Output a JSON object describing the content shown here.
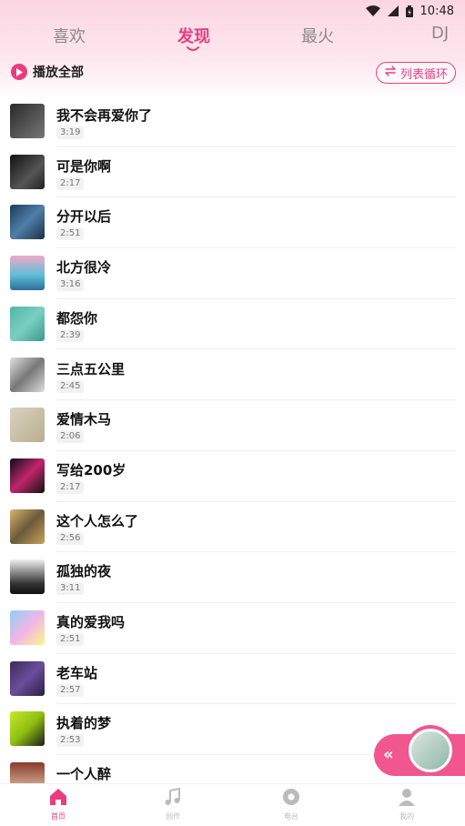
{
  "status_bar": {
    "time": "10:48"
  },
  "tabs": [
    {
      "label": "喜欢"
    },
    {
      "label": "发现"
    },
    {
      "label": "最火"
    },
    {
      "label": "DJ"
    }
  ],
  "active_tab": "发现",
  "toolbar": {
    "play_all_label": "播放全部",
    "loop_label": "列表循环"
  },
  "songs": [
    {
      "title": "我不会再爱你了",
      "duration": "3:19"
    },
    {
      "title": "可是你啊",
      "duration": "2:17"
    },
    {
      "title": "分开以后",
      "duration": "2:51"
    },
    {
      "title": "北方很冷",
      "duration": "3:16"
    },
    {
      "title": "都怨你",
      "duration": "2:39"
    },
    {
      "title": "三点五公里",
      "duration": "2:45"
    },
    {
      "title": "爱情木马",
      "duration": "2:06"
    },
    {
      "title": "写给200岁",
      "duration": "2:17"
    },
    {
      "title": "这个人怎么了",
      "duration": "2:56"
    },
    {
      "title": "孤独的夜",
      "duration": "3:11"
    },
    {
      "title": "真的爱我吗",
      "duration": "2:51"
    },
    {
      "title": "老车站",
      "duration": "2:57"
    },
    {
      "title": "执着的梦",
      "duration": "2:53"
    },
    {
      "title": "一个人醉",
      "duration": ""
    }
  ],
  "bottom_nav": [
    {
      "label": "首页",
      "icon": "home-icon"
    },
    {
      "label": "创作",
      "icon": "music-note-icon"
    },
    {
      "label": "电台",
      "icon": "radio-icon"
    },
    {
      "label": "我的",
      "icon": "user-icon"
    }
  ],
  "colors": {
    "accent": "#ea3d7e"
  }
}
